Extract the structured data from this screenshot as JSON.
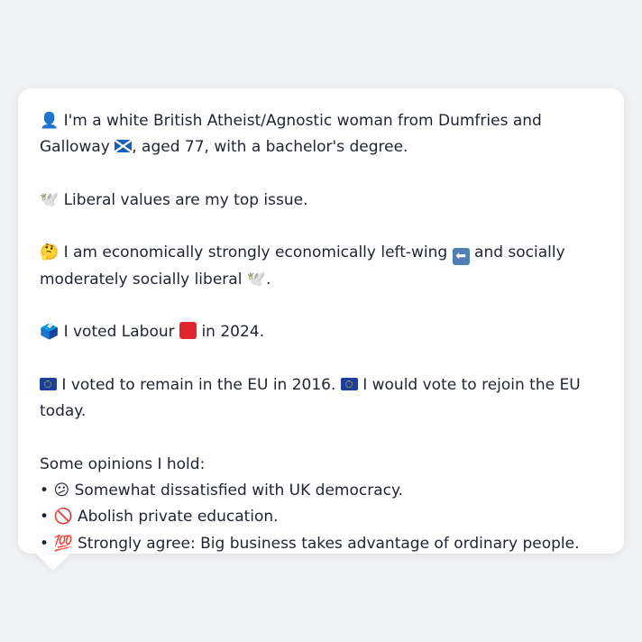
{
  "profile": {
    "intro": {
      "icon": "person-silhouette-icon",
      "text_before_flag": "I'm a white British Atheist/Agnostic woman from Dumfries and Galloway",
      "flag_icon": "scotland-flag-icon",
      "text_after_flag": ", aged 77, with a bachelor's degree."
    },
    "top_issue": {
      "icon": "dove-icon",
      "text": "Liberal values are my top issue."
    },
    "position": {
      "icon": "thinking-face-icon",
      "text_before_arrow": "I am economically strongly economically left-wing",
      "arrow_icon": "left-arrow-icon",
      "text_after_arrow": "and socially moderately socially liberal",
      "end_icon": "dove-icon",
      "end_punct": "."
    },
    "vote_2024": {
      "icon": "ballot-box-icon",
      "text_before": "I voted Labour",
      "party_icon": "red-square-icon",
      "text_after": "in 2024."
    },
    "eu": {
      "icon": "eu-flag-icon",
      "text1": "I voted to remain in the EU in 2016.",
      "text2": "I would vote to rejoin the EU today."
    },
    "opinions_heading": "Some opinions I hold:",
    "opinions": [
      {
        "bullet": "•",
        "icon": "confused-face-icon",
        "glyph": "😕",
        "text": "Somewhat dissatisfied with UK democracy."
      },
      {
        "bullet": "•",
        "icon": "prohibited-icon",
        "glyph": "🚫",
        "text": "Abolish private education."
      },
      {
        "bullet": "•",
        "icon": "hundred-points-icon",
        "glyph": "💯",
        "text": "Strongly agree: Big business takes advantage of ordinary people."
      }
    ]
  },
  "glyphs": {
    "person": "👤",
    "dove": "🕊️",
    "thinking": "🤔",
    "arrow": "⬅",
    "ballot": "🗳️"
  },
  "colors": {
    "background": "#f1f2f4",
    "card": "#ffffff",
    "text": "#1f2430",
    "labour_red": "#e2262b",
    "eu_blue": "#1c3f9c"
  }
}
